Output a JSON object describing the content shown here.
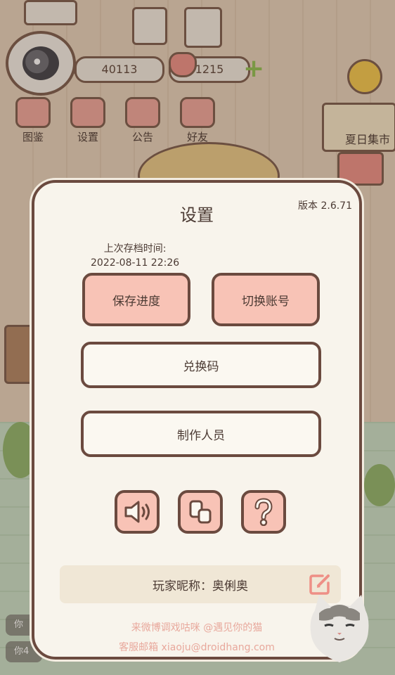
{
  "hud": {
    "coins": "40113",
    "hearts": "1215",
    "buttons": [
      {
        "label": "图鉴"
      },
      {
        "label": "设置"
      },
      {
        "label": "公告"
      },
      {
        "label": "好友"
      }
    ],
    "market_label": "夏日集市"
  },
  "dialog": {
    "title": "设置",
    "version": "版本 2.6.71",
    "save_time_label": "上次存档时间:",
    "save_time_value": "2022-08-11 22:26",
    "save_button": "保存进度",
    "switch_account_button": "切换账号",
    "redeem_button": "兑换码",
    "credits_button": "制作人员",
    "icon_buttons": [
      "sound-icon",
      "music-icon",
      "help-icon"
    ],
    "nickname_label": "玩家昵称：奥俐奥",
    "footer_weibo": "来微博调戏咕咪 @遇见你的猫",
    "footer_email": "客服邮箱 xiaoju@droidhang.com"
  },
  "background_chat": [
    "你",
    "你4"
  ],
  "colors": {
    "accent_pink": "#f8c3b6",
    "border_brown": "#6b4a3f",
    "panel_bg": "#f8f4ec",
    "footer_pink": "#e8a89c"
  }
}
